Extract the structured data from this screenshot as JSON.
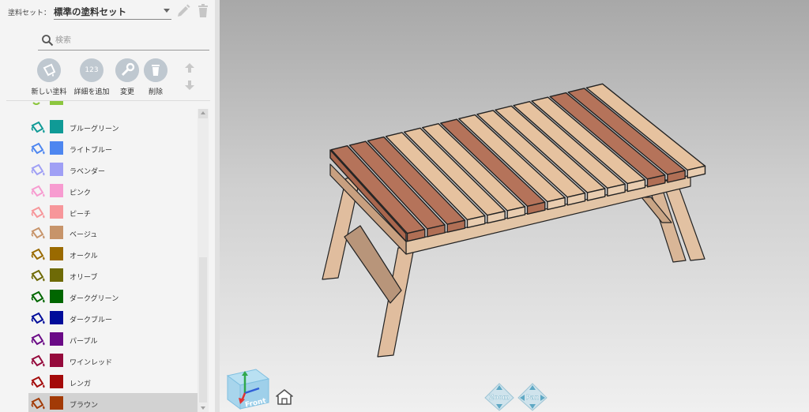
{
  "palette_set": {
    "label": "塗料セット：",
    "selected": "標準の塗料セット"
  },
  "search": {
    "placeholder": "検索",
    "value": ""
  },
  "toolbar": [
    {
      "label": "新しい塗料",
      "icon": "bucket-icon"
    },
    {
      "label": "詳細を追加",
      "icon": "123-icon",
      "glyph": "123"
    },
    {
      "label": "変更",
      "icon": "wrench-icon"
    },
    {
      "label": "削除",
      "icon": "trash-icon"
    }
  ],
  "paints": [
    {
      "name": "ブルーグリーン",
      "color": "#0f9a96"
    },
    {
      "name": "ライトブルー",
      "color": "#4d86f0"
    },
    {
      "name": "ラベンダー",
      "color": "#9f9ff5"
    },
    {
      "name": "ピンク",
      "color": "#f79bd0"
    },
    {
      "name": "ピーチ",
      "color": "#f7969a"
    },
    {
      "name": "ベージュ",
      "color": "#c7946a"
    },
    {
      "name": "オークル",
      "color": "#9a6a00"
    },
    {
      "name": "オリーブ",
      "color": "#6e6a06"
    },
    {
      "name": "ダークグリーン",
      "color": "#006600"
    },
    {
      "name": "ダークブルー",
      "color": "#000c9a"
    },
    {
      "name": "パープル",
      "color": "#6a0a86"
    },
    {
      "name": "ワインレッド",
      "color": "#950a3c"
    },
    {
      "name": "レンガ",
      "color": "#a40a0a"
    },
    {
      "name": "ブラウン",
      "color": "#a23a06"
    }
  ],
  "selected_paint": "ブラウン",
  "partial_top_color": "#8cc63e",
  "viewport": {
    "view_cube_face": "Front",
    "zoom_label": "Zoom",
    "pan_label": "Pan"
  },
  "colors": {
    "light_wood": "#e6c29f",
    "dark_wood": "#b5735a",
    "leg_wood": "#dbb89a",
    "icon_gray": "#bfc8d0"
  }
}
